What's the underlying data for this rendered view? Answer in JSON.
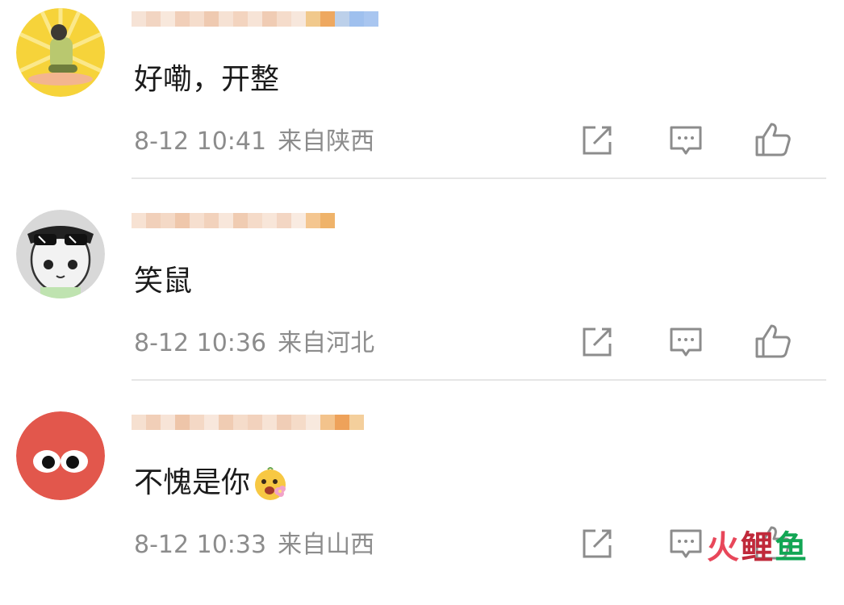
{
  "comments": [
    {
      "text": "好嘞，开整",
      "time": "8-12 10:41",
      "location": "来自陕西",
      "has_emoji": false
    },
    {
      "text": "笑鼠",
      "time": "8-12 10:36",
      "location": "来自河北",
      "has_emoji": false
    },
    {
      "text": "不愧是你",
      "time": "8-12 10:33",
      "location": "来自山西",
      "has_emoji": true,
      "emoji": "flower-face-emoji"
    }
  ],
  "actions": {
    "share_icon": "share-icon",
    "comment_icon": "comment-icon",
    "like_icon": "thumbs-up-icon"
  },
  "watermark": {
    "text": [
      "火",
      "鲤",
      "鱼"
    ],
    "colors": [
      "#e8475a",
      "#c02a3b",
      "#12a654"
    ]
  },
  "colors": {
    "text": "#1b1b1b",
    "meta": "#8c8c8c",
    "divider": "#e6e6e6",
    "avatar3_bg": "#e2574c",
    "avatar1_bg": "#f6d33a"
  }
}
